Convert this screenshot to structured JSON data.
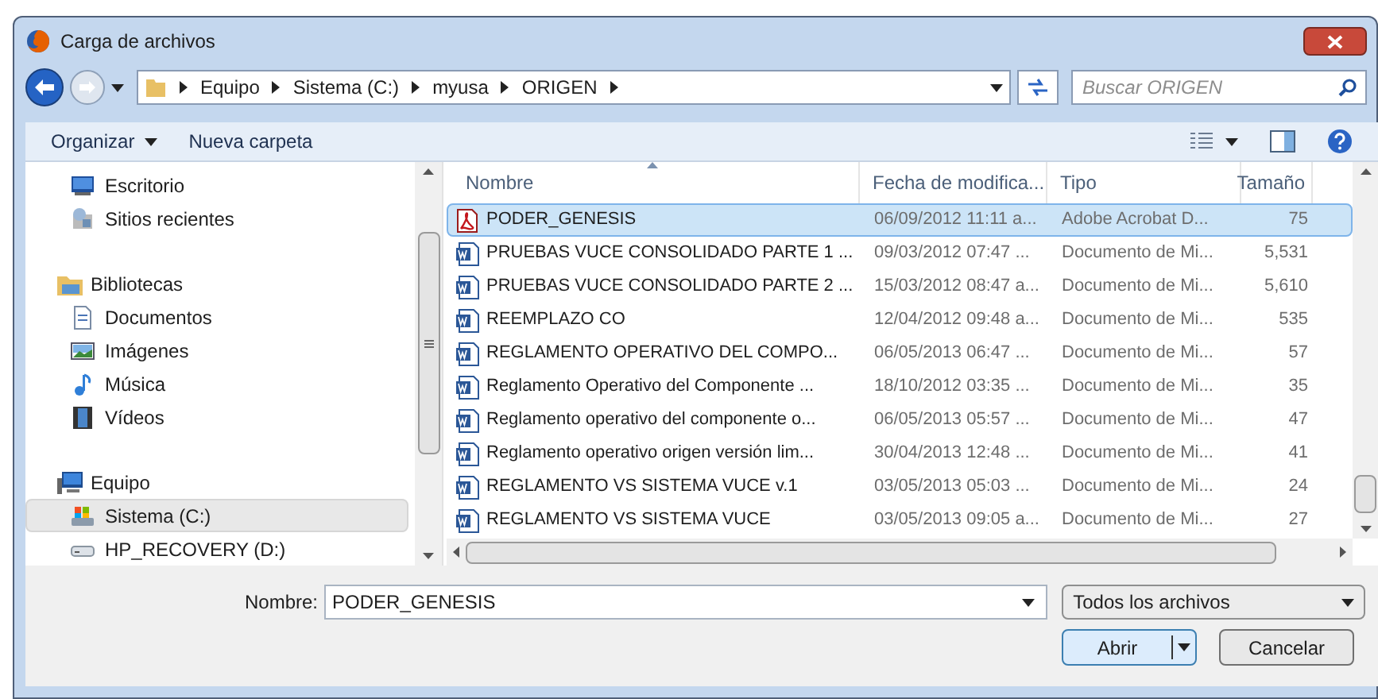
{
  "window": {
    "title": "Carga de archivos"
  },
  "address": {
    "segments": [
      "Equipo",
      "Sistema (C:)",
      "myusa",
      "ORIGEN"
    ]
  },
  "search": {
    "placeholder": "Buscar ORIGEN"
  },
  "toolbar": {
    "buttons": [
      "Organizar",
      "Nueva carpeta"
    ]
  },
  "sidebar": {
    "groups": [
      {
        "items": [
          {
            "label": "Escritorio",
            "selected": false
          },
          {
            "label": "Sitios recientes",
            "selected": false
          }
        ]
      },
      {
        "label": "Bibliotecas",
        "children": [
          {
            "label": "Documentos",
            "selected": false
          },
          {
            "label": "Imágenes",
            "selected": false
          },
          {
            "label": "Música",
            "selected": false
          },
          {
            "label": "Vídeos",
            "selected": false
          }
        ]
      },
      {
        "label": "Equipo",
        "children": [
          {
            "label": "Sistema (C:)",
            "selected": true
          },
          {
            "label": "HP_RECOVERY (D:)",
            "selected": false
          }
        ]
      }
    ]
  },
  "table": {
    "columns": [
      "Nombre",
      "Fecha de modifica...",
      "Tipo",
      "Tamaño"
    ],
    "rows": [
      {
        "kind": "pdf",
        "selected": true,
        "cells": [
          "PODER_GENESIS",
          "06/09/2012 11:11 a...",
          "Adobe Acrobat D...",
          "75"
        ]
      },
      {
        "kind": "word",
        "selected": false,
        "cells": [
          "PRUEBAS VUCE CONSOLIDADO PARTE 1 ...",
          "09/03/2012 07:47 ...",
          "Documento de Mi...",
          "5,531"
        ]
      },
      {
        "kind": "word",
        "selected": false,
        "cells": [
          "PRUEBAS VUCE CONSOLIDADO PARTE 2 ...",
          "15/03/2012 08:47 a...",
          "Documento de Mi...",
          "5,610"
        ]
      },
      {
        "kind": "word",
        "selected": false,
        "cells": [
          "REEMPLAZO CO",
          "12/04/2012 09:48 a...",
          "Documento de Mi...",
          "535"
        ]
      },
      {
        "kind": "word",
        "selected": false,
        "cells": [
          "REGLAMENTO OPERATIVO DEL COMPO...",
          "06/05/2013 06:47 ...",
          "Documento de Mi...",
          "57"
        ]
      },
      {
        "kind": "word",
        "selected": false,
        "cells": [
          "Reglamento Operativo del Componente ...",
          "18/10/2012 03:35 ...",
          "Documento de Mi...",
          "35"
        ]
      },
      {
        "kind": "word",
        "selected": false,
        "cells": [
          "Reglamento operativo del componente o...",
          "06/05/2013 05:57 ...",
          "Documento de Mi...",
          "47"
        ]
      },
      {
        "kind": "word",
        "selected": false,
        "cells": [
          "Reglamento operativo origen versión lim...",
          "30/04/2013 12:48 ...",
          "Documento de Mi...",
          "41"
        ]
      },
      {
        "kind": "word",
        "selected": false,
        "cells": [
          "REGLAMENTO VS SISTEMA VUCE v.1",
          "03/05/2013 05:03 ...",
          "Documento de Mi...",
          "24"
        ]
      },
      {
        "kind": "word",
        "selected": false,
        "cells": [
          "REGLAMENTO VS SISTEMA VUCE",
          "03/05/2013 09:05 a...",
          "Documento de Mi...",
          "27"
        ]
      }
    ]
  },
  "filename": {
    "label": "Nombre:",
    "value": "PODER_GENESIS"
  },
  "filter": {
    "value": "Todos los archivos"
  },
  "buttons": [
    "Abrir",
    "Cancelar"
  ]
}
